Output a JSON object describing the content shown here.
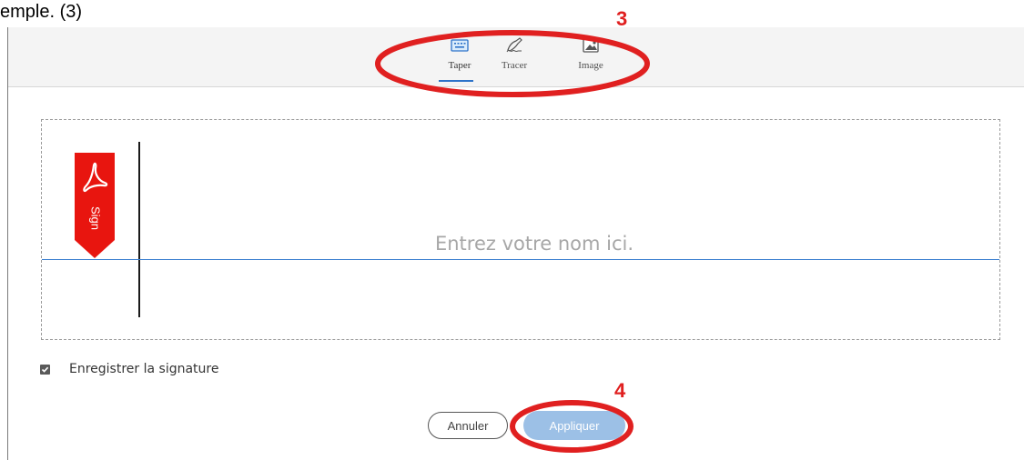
{
  "document": {
    "caption": "emple. (3)"
  },
  "tabs": [
    {
      "label": "Taper",
      "icon": "keyboard-icon",
      "active": true
    },
    {
      "label": "Tracer",
      "icon": "pen-draw-icon",
      "active": false
    },
    {
      "label": "Image",
      "icon": "image-icon",
      "active": false
    }
  ],
  "signature": {
    "placeholder": "Entrez votre nom ici.",
    "badge_text": "Sign",
    "badge_icon": "adobe-acrobat-icon"
  },
  "footer": {
    "save_checked": true,
    "save_label": "Enregistrer la signature",
    "cancel_label": "Annuler",
    "apply_label": "Appliquer"
  },
  "annotations": [
    {
      "number": "3",
      "target": "tabs",
      "color": "#e02020"
    },
    {
      "number": "4",
      "target": "apply-button",
      "color": "#e02020"
    }
  ],
  "colors": {
    "accent": "#2d73c9",
    "apply_button": "#9cc0e6",
    "adobe_red": "#e8150f",
    "annotation_red": "#e02020"
  }
}
